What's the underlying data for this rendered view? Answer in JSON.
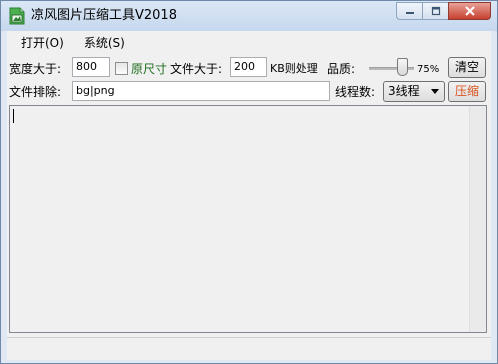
{
  "window": {
    "title": "凉风图片压缩工具V2018",
    "icon": "image-icon",
    "controls": [
      "minimize-icon",
      "maximize-icon",
      "close-icon"
    ]
  },
  "menu": {
    "items": [
      "打开(O)",
      "系统(S)"
    ]
  },
  "settings": {
    "width_label": "宽度大于:",
    "width_value": "800",
    "original_size_label": "原尺寸",
    "original_size_checked": false,
    "original_size_color": "#1e6d1e",
    "filesize_label": "文件大于:",
    "filesize_value": "200",
    "filesize_unit": "KB则处理",
    "quality_label": "品质:",
    "quality_value": "75%",
    "quality_fraction": 0.75,
    "clear_button": "清空",
    "exclude_label": "文件排除:",
    "exclude_value": "bg|png",
    "threads_label": "线程数:",
    "threads_value": "3线程",
    "compress_button": "压缩",
    "compress_color": "#d9531e"
  },
  "log": {
    "text": ""
  },
  "status": {
    "text": ""
  }
}
